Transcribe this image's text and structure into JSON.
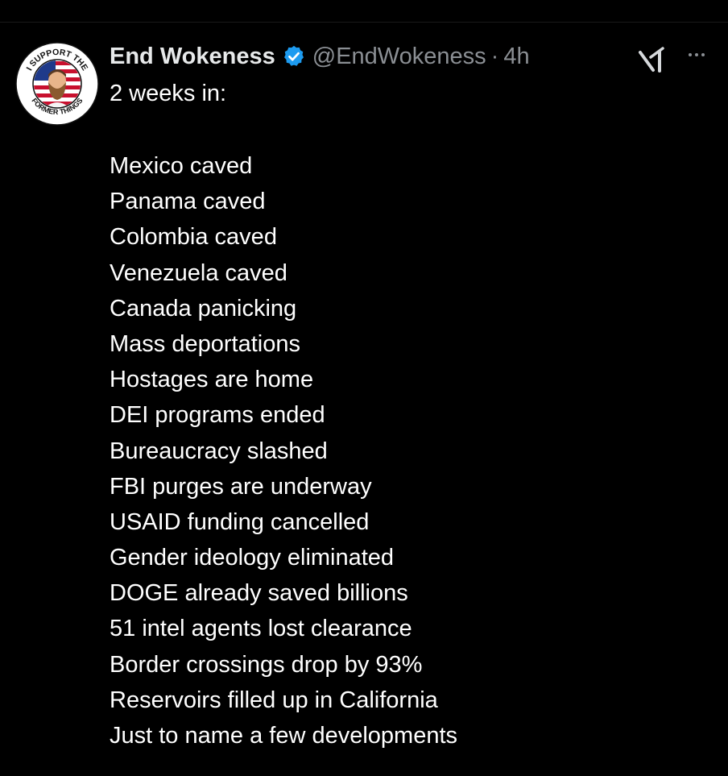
{
  "tweet": {
    "display_name": "End Wokeness",
    "handle": "@EndWokeness",
    "separator": "·",
    "time": "4h",
    "verified": true,
    "intro": "2 weeks in:",
    "lines": [
      "Mexico caved",
      "Panama caved",
      "Colombia caved",
      "Venezuela caved",
      "Canada panicking",
      "Mass deportations",
      "Hostages are home",
      "DEI programs ended",
      "Bureaucracy slashed",
      "FBI purges are underway",
      "USAID funding cancelled",
      "Gender ideology eliminated",
      "DOGE already saved billions",
      "51 intel agents lost clearance",
      "Border crossings drop by 93%",
      "Reservoirs filled up in California",
      "Just to name a few developments"
    ]
  },
  "avatar": {
    "text_top": "I SUPPORT THE",
    "text_bottom": "FORMER THINGS"
  },
  "icons": {
    "verified": "verified-badge-icon",
    "grok": "grok-icon",
    "more": "more-options-icon"
  },
  "colors": {
    "background": "#000000",
    "primary_text": "#e7e9ea",
    "secondary_text": "#8b8f94",
    "verified_blue": "#1d9bf0"
  }
}
